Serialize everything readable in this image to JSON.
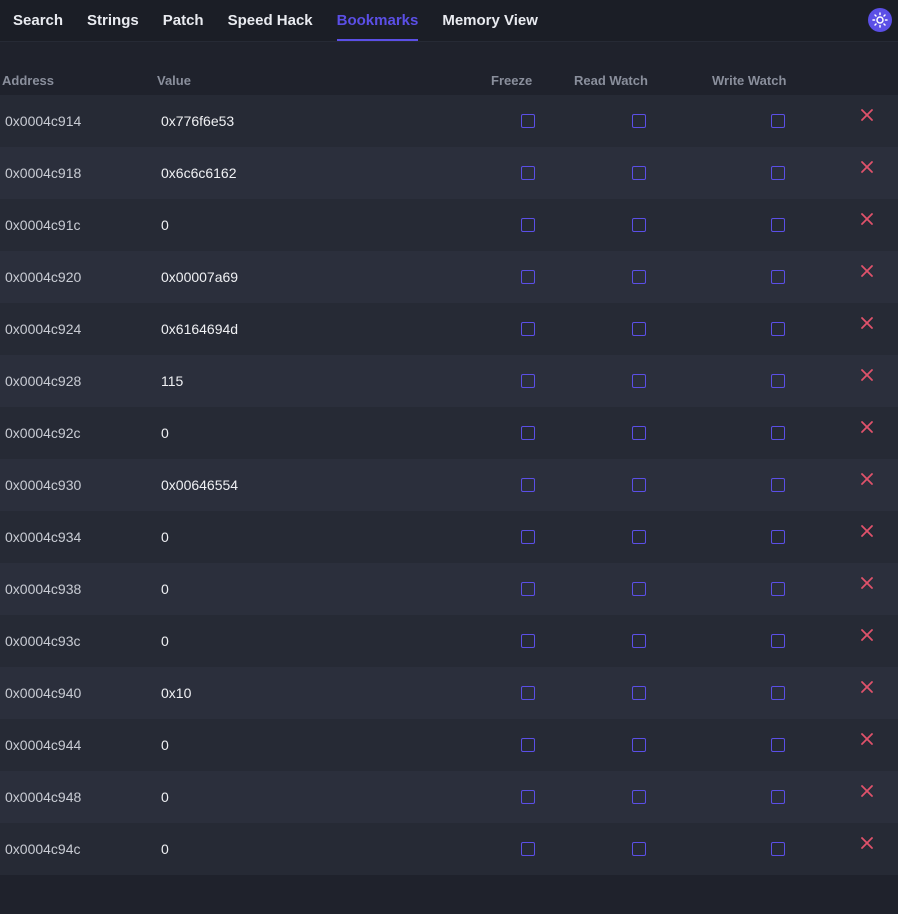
{
  "tabs": [
    {
      "label": "Search"
    },
    {
      "label": "Strings"
    },
    {
      "label": "Patch"
    },
    {
      "label": "Speed Hack"
    },
    {
      "label": "Bookmarks"
    },
    {
      "label": "Memory View"
    }
  ],
  "active_tab": "Bookmarks",
  "theme_icon": "sun-icon",
  "columns": {
    "address": "Address",
    "value": "Value",
    "freeze": "Freeze",
    "read_watch": "Read Watch",
    "write_watch": "Write Watch"
  },
  "rows": [
    {
      "address": "0x0004c914",
      "value": "0x776f6e53",
      "freeze": false,
      "read_watch": false,
      "write_watch": false
    },
    {
      "address": "0x0004c918",
      "value": "0x6c6c6162",
      "freeze": false,
      "read_watch": false,
      "write_watch": false
    },
    {
      "address": "0x0004c91c",
      "value": "0",
      "freeze": false,
      "read_watch": false,
      "write_watch": false
    },
    {
      "address": "0x0004c920",
      "value": "0x00007a69",
      "freeze": false,
      "read_watch": false,
      "write_watch": false
    },
    {
      "address": "0x0004c924",
      "value": "0x6164694d",
      "freeze": false,
      "read_watch": false,
      "write_watch": false
    },
    {
      "address": "0x0004c928",
      "value": "115",
      "freeze": false,
      "read_watch": false,
      "write_watch": false
    },
    {
      "address": "0x0004c92c",
      "value": "0",
      "freeze": false,
      "read_watch": false,
      "write_watch": false
    },
    {
      "address": "0x0004c930",
      "value": "0x00646554",
      "freeze": false,
      "read_watch": false,
      "write_watch": false
    },
    {
      "address": "0x0004c934",
      "value": "0",
      "freeze": false,
      "read_watch": false,
      "write_watch": false
    },
    {
      "address": "0x0004c938",
      "value": "0",
      "freeze": false,
      "read_watch": false,
      "write_watch": false
    },
    {
      "address": "0x0004c93c",
      "value": "0",
      "freeze": false,
      "read_watch": false,
      "write_watch": false
    },
    {
      "address": "0x0004c940",
      "value": "0x10",
      "freeze": false,
      "read_watch": false,
      "write_watch": false
    },
    {
      "address": "0x0004c944",
      "value": "0",
      "freeze": false,
      "read_watch": false,
      "write_watch": false
    },
    {
      "address": "0x0004c948",
      "value": "0",
      "freeze": false,
      "read_watch": false,
      "write_watch": false
    },
    {
      "address": "0x0004c94c",
      "value": "0",
      "freeze": false,
      "read_watch": false,
      "write_watch": false
    }
  ],
  "colors": {
    "accent": "#5b4fe6",
    "delete": "#e0526b",
    "background": "#1f222c"
  },
  "delete_icon": "close-icon"
}
